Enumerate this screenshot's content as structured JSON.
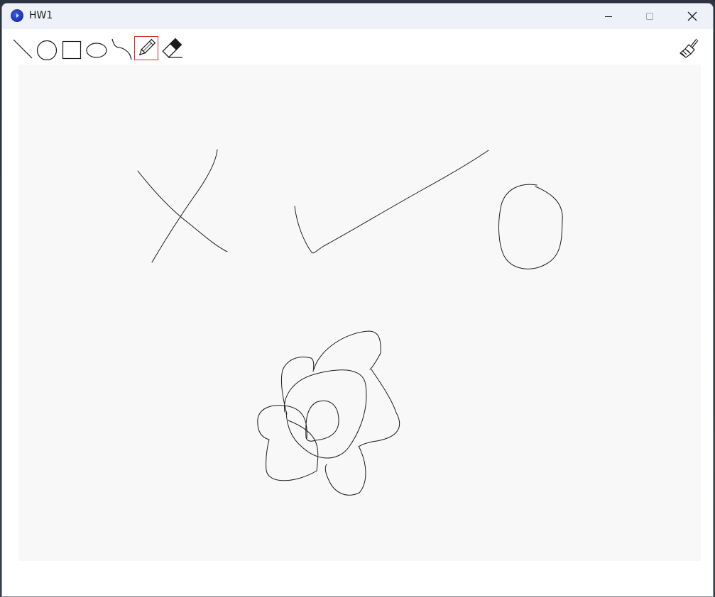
{
  "window": {
    "title": "HW1",
    "app_icon": "app-logo-icon"
  },
  "titlebar_buttons": [
    {
      "name": "minimize-button",
      "icon": "minimize-icon"
    },
    {
      "name": "maximize-button",
      "icon": "maximize-icon",
      "enabled": false
    },
    {
      "name": "close-button",
      "icon": "close-icon"
    }
  ],
  "toolbar": {
    "tools": [
      {
        "name": "line-tool",
        "icon": "line-icon",
        "selected": false
      },
      {
        "name": "circle-tool",
        "icon": "circle-icon",
        "selected": false
      },
      {
        "name": "rectangle-tool",
        "icon": "rectangle-icon",
        "selected": false
      },
      {
        "name": "ellipse-tool",
        "icon": "ellipse-icon",
        "selected": false
      },
      {
        "name": "curve-tool",
        "icon": "curve-icon",
        "selected": false
      },
      {
        "name": "pencil-tool",
        "icon": "pencil-icon",
        "selected": true
      },
      {
        "name": "eraser-tool",
        "icon": "eraser-icon",
        "selected": false
      }
    ],
    "clear_tool": {
      "name": "clear-canvas-tool",
      "icon": "broom-icon"
    },
    "selected_color": "#d42c2c"
  },
  "canvas": {
    "background": "#f8f8f8",
    "stroke_color": "#1b1b1b",
    "strokes": [
      {
        "name": "freehand-x-mark"
      },
      {
        "name": "freehand-check-mark"
      },
      {
        "name": "freehand-oval"
      },
      {
        "name": "freehand-flower"
      }
    ]
  }
}
